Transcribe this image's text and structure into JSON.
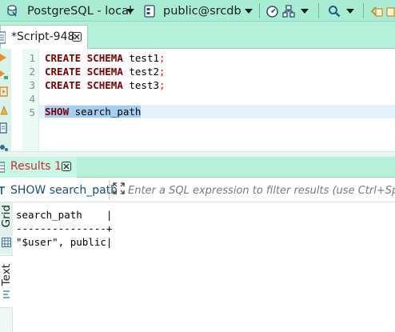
{
  "toolbar": {
    "connection": "PostgreSQL - local",
    "schema": "public@srcdb"
  },
  "editor": {
    "tab_label": "*Script-948",
    "line_numbers": [
      "1",
      "2",
      "3",
      "4",
      "5"
    ],
    "lines": [
      {
        "kw1": "CREATE",
        "kw2": "SCHEMA",
        "ident": "test1",
        "punc": ";"
      },
      {
        "kw1": "CREATE",
        "kw2": "SCHEMA",
        "ident": "test2",
        "punc": ";"
      },
      {
        "kw1": "CREATE",
        "kw2": "SCHEMA",
        "ident": "test3",
        "punc": ";"
      },
      {},
      {
        "kw1": "SHOW",
        "ident": "search_path"
      }
    ]
  },
  "results": {
    "tab_label": "Results 1",
    "query_label": "SHOW search_path",
    "filter_placeholder": "Enter a SQL expression to filter results (use Ctrl+Space)",
    "view_tabs": {
      "grid": "Grid",
      "text": "Text"
    },
    "text_output": {
      "header": "search_path    |",
      "divider": "---------------+",
      "row": "\"$user\", public|"
    }
  },
  "colors": {
    "accent_bg": "#a9ecd4",
    "keyword": "#7f0000",
    "result_tab_label": "#c2303a",
    "selection": "#a6cef0"
  }
}
